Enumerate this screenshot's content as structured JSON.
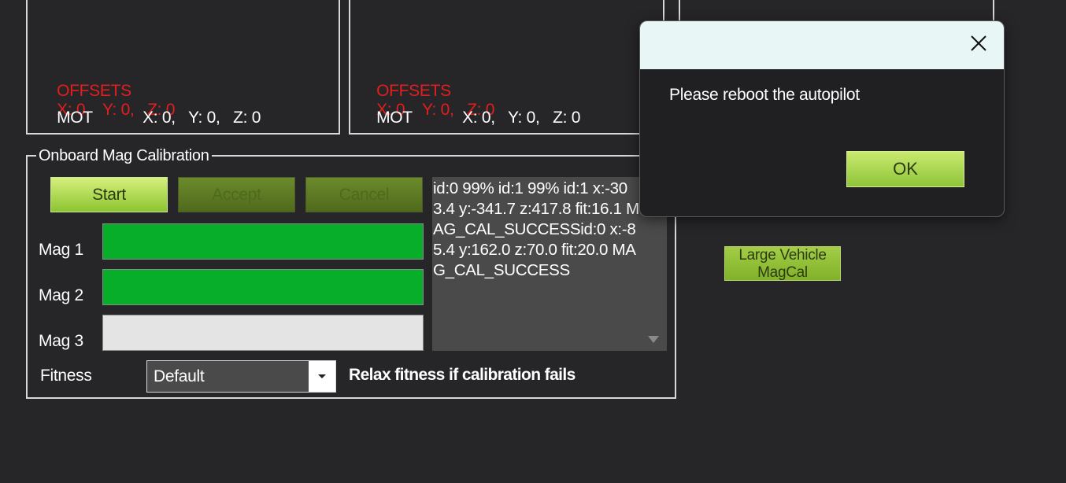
{
  "compass_panels": [
    {
      "offsets_label": "OFFSETS",
      "offsets_values": "X: 0,   Y: 0,   Z: 0",
      "mot_label": "MOT",
      "mot_values": "X: 0,   Y: 0,   Z: 0"
    },
    {
      "offsets_label": "OFFSETS",
      "offsets_values": "X: 0,   Y: 0,   Z: 0",
      "mot_label": "MOT",
      "mot_values": "X: 0,   Y: 0,   Z: 0"
    }
  ],
  "onboard_mag": {
    "title": "Onboard Mag Calibration",
    "buttons": {
      "start": "Start",
      "accept": "Accept",
      "cancel": "Cancel"
    },
    "mags": [
      {
        "label": "Mag 1",
        "progress_percent": 100
      },
      {
        "label": "Mag 2",
        "progress_percent": 100
      },
      {
        "label": "Mag 3",
        "progress_percent": 0
      }
    ],
    "log_text": "id:0 99% id:1 99% id:1 x:-303.4 y:-341.7 z:417.8 fit:16.1 MAG_CAL_SUCCESSid:0 x:-85.4 y:162.0 z:70.0 fit:20.0 MAG_CAL_SUCCESS",
    "fitness_label": "Fitness",
    "fitness_value": "Default",
    "relax_label": "Relax fitness if calibration fails"
  },
  "large_vehicle_button": "Large Vehicle MagCal",
  "dialog": {
    "message": "Please reboot the autopilot",
    "ok_label": "OK"
  },
  "colors": {
    "background": "#262629",
    "offsets_red": "#e41d1d",
    "progress_green": "#06ae2a",
    "button_green": "#a3cd46",
    "dialog_title_bg": "#e8f6f5"
  }
}
